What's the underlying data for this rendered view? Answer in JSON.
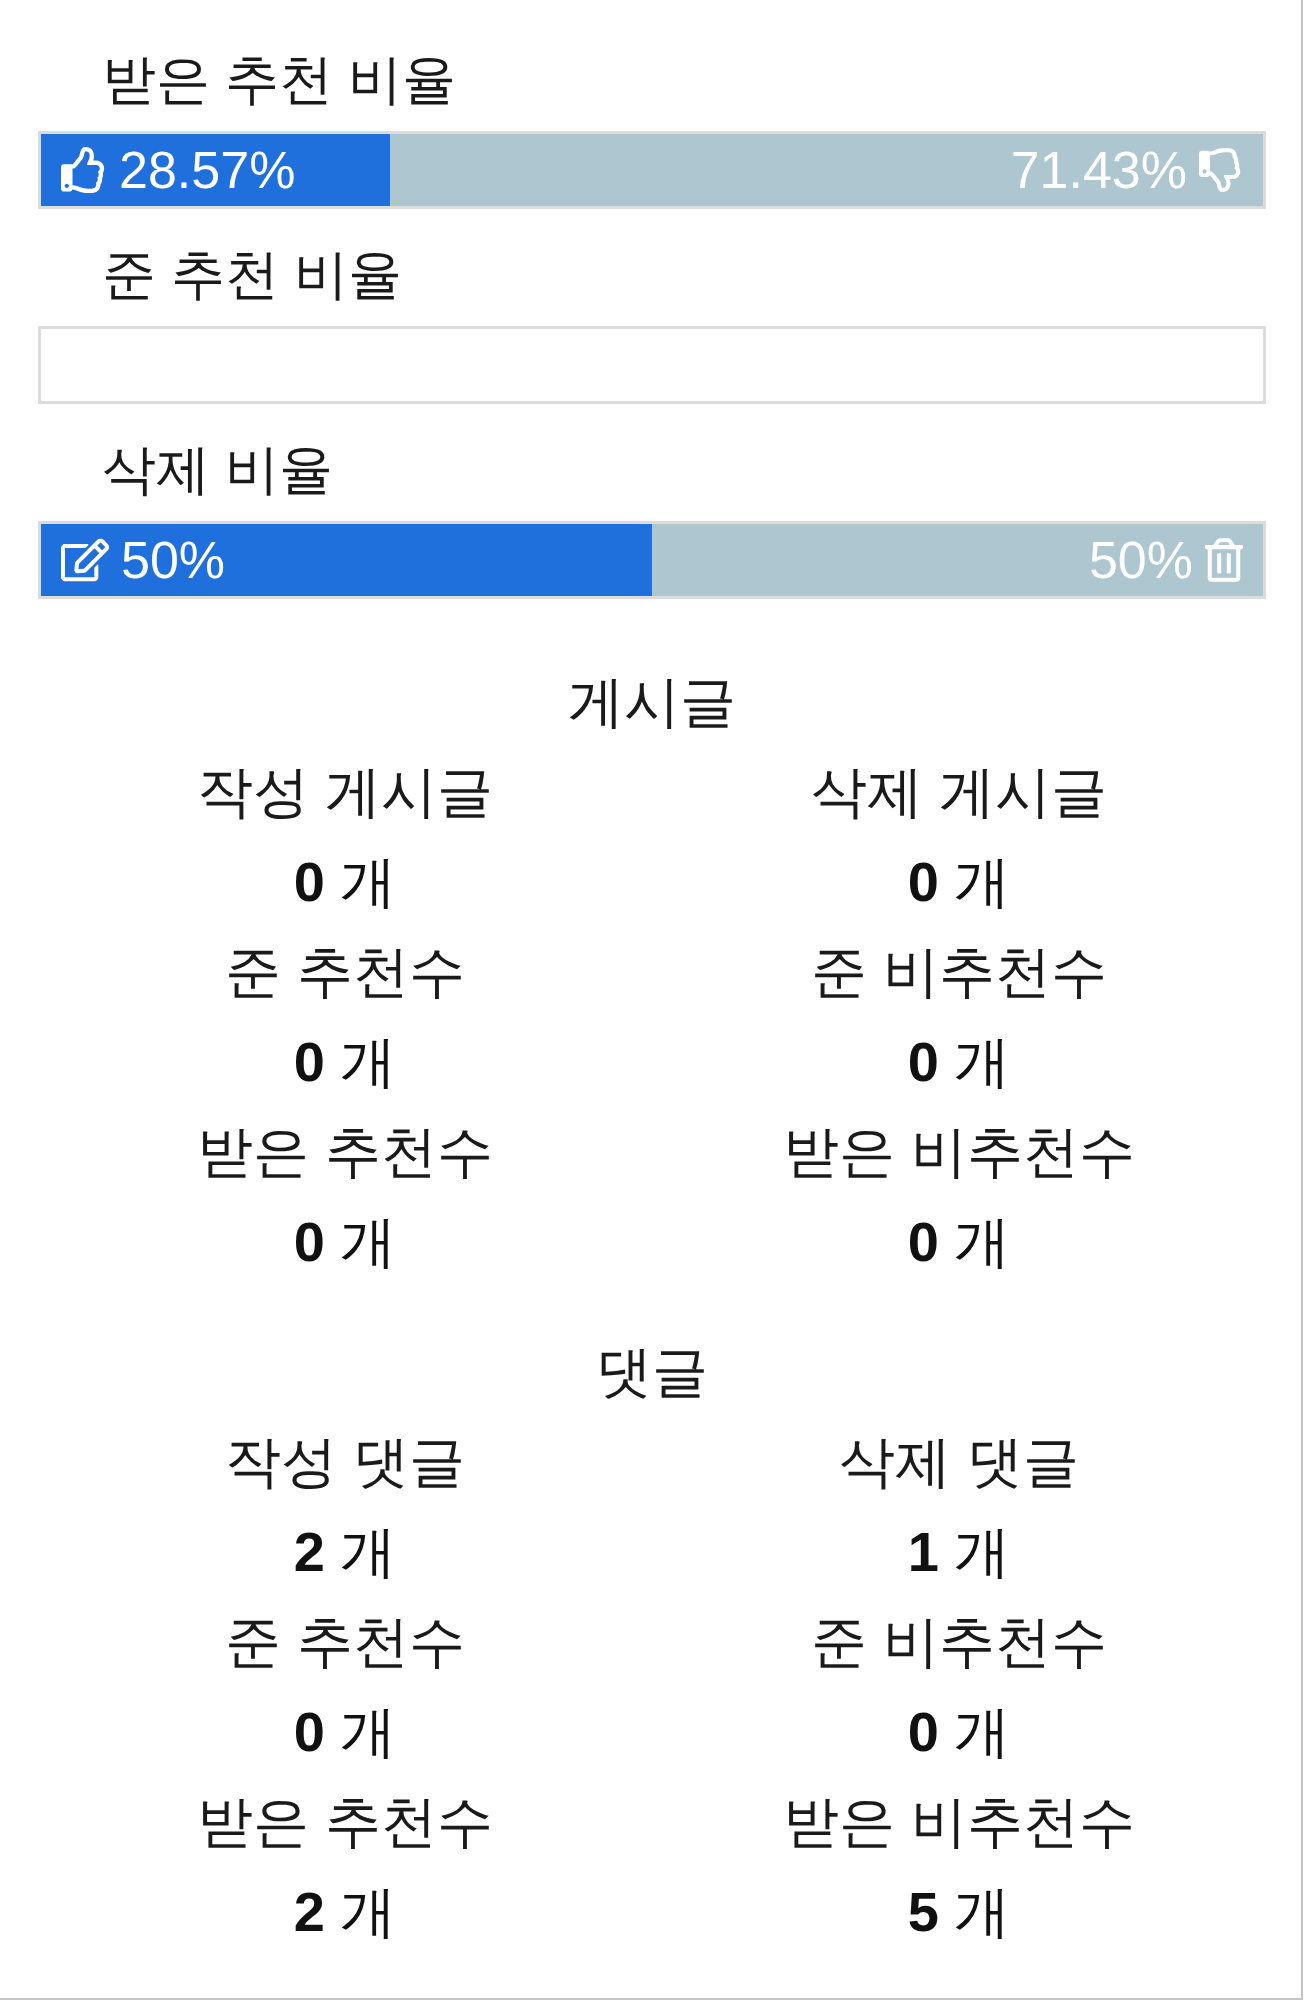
{
  "ratios": [
    {
      "kind": "likes",
      "label": "받은 추천 비율",
      "level": 0.2857,
      "left_text": "28.57%",
      "right_text": "71.43%"
    },
    {
      "kind": "empty",
      "label": "준 추천 비율"
    },
    {
      "kind": "edits",
      "label": "삭제 비율",
      "level": 0.5,
      "left_text": "50%",
      "right_text": "50%"
    }
  ],
  "sections": [
    {
      "title": "게시글",
      "stats": [
        {
          "label": "작성 게시글",
          "value": "**0** 개"
        },
        {
          "label": "삭제 게시글",
          "value": "**0** 개"
        },
        {
          "label": "준 추천수",
          "value": "**0** 개"
        },
        {
          "label": "준 비추천수",
          "value": "**0** 개"
        },
        {
          "label": "받은 추천수",
          "value": "**0** 개"
        },
        {
          "label": "받은 비추천수",
          "value": "**0** 개"
        }
      ]
    },
    {
      "title": "댓글",
      "stats": [
        {
          "label": "작성 댓글",
          "value": "**2** 개"
        },
        {
          "label": "삭제 댓글",
          "value": "**1** 개"
        },
        {
          "label": "준 추천수",
          "value": "**0** 개"
        },
        {
          "label": "준 비추천수",
          "value": "**0** 개"
        },
        {
          "label": "받은 추천수",
          "value": "**2** 개"
        },
        {
          "label": "받은 비추천수",
          "value": "**5** 개"
        }
      ]
    }
  ]
}
